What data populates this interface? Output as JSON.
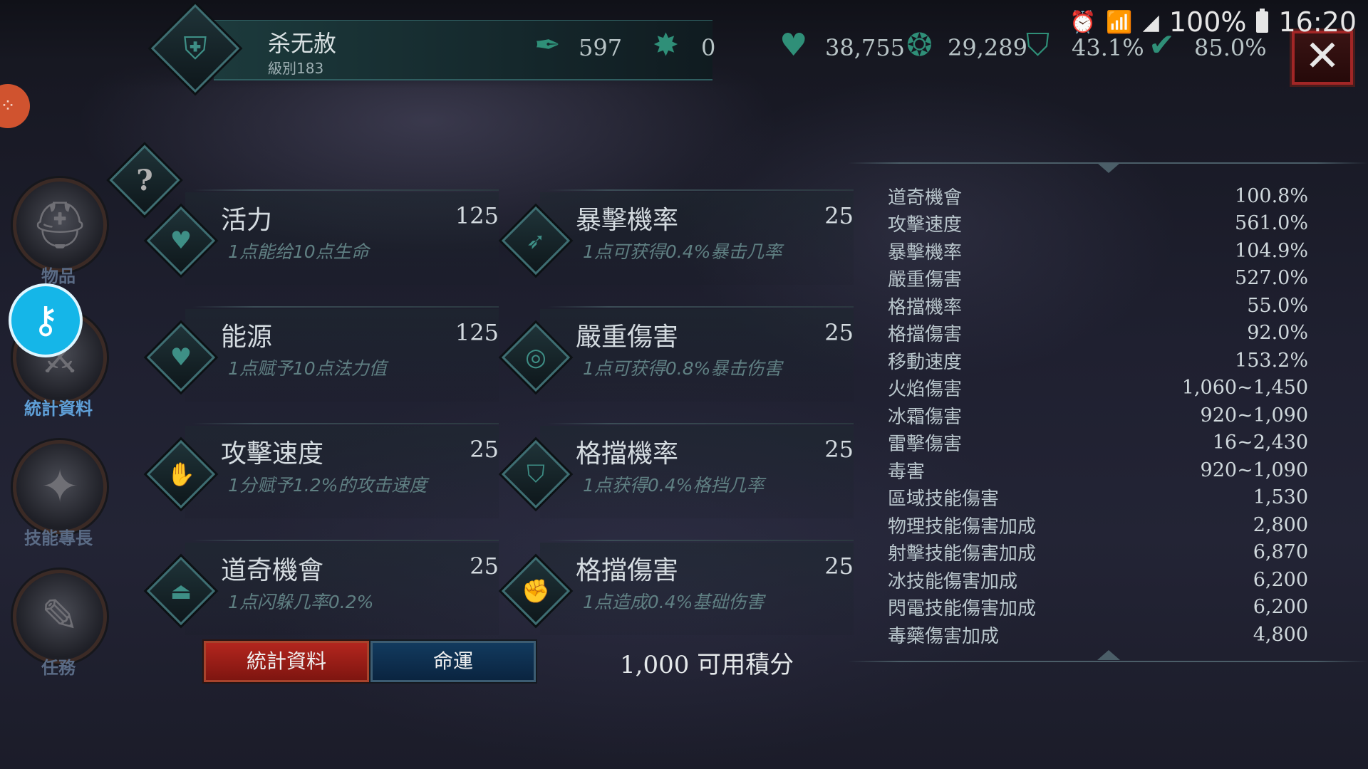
{
  "status_bar": {
    "battery": "100%",
    "time": "16:20",
    "alarm_icon": "alarm-icon",
    "wifi_icon": "wifi-icon",
    "signal_icon": "signal-icon"
  },
  "character": {
    "name": "杀无赦",
    "level": "級別183",
    "portrait_icon": "spartan-helmet-icon"
  },
  "resources": [
    {
      "icon": "feather-icon",
      "value": "597"
    },
    {
      "icon": "splash-icon",
      "value": "0"
    },
    {
      "icon": "heart-icon",
      "value": "38,755"
    },
    {
      "icon": "flame-icon",
      "value": "29,289"
    },
    {
      "icon": "shield-icon",
      "value": "43.1%"
    },
    {
      "icon": "shield-check-icon",
      "value": "85.0%"
    }
  ],
  "nav": [
    {
      "label": "物品",
      "icon": "helmet-icon",
      "active": false
    },
    {
      "label": "統計資料",
      "icon": "crossed-swords-icon",
      "active": true
    },
    {
      "label": "技能專長",
      "icon": "star-skill-icon",
      "active": false
    },
    {
      "label": "任務",
      "icon": "scroll-quill-icon",
      "active": false
    }
  ],
  "attributes": {
    "left": [
      {
        "name": "活力",
        "value": "125",
        "desc": "1点能给10点生命",
        "icon": "heart-icon"
      },
      {
        "name": "能源",
        "value": "125",
        "desc": "1点赋予10点法力值",
        "icon": "heart-icon"
      },
      {
        "name": "攻擊速度",
        "value": "25",
        "desc": "1分赋予1.2%的攻击速度",
        "icon": "gauntlet-icon"
      },
      {
        "name": "道奇機會",
        "value": "25",
        "desc": "1点闪躲几率0.2%",
        "icon": "boot-icon"
      }
    ],
    "right": [
      {
        "name": "暴擊機率",
        "value": "25",
        "desc": "1点可获得0.4%暴击几率",
        "icon": "crossbow-icon"
      },
      {
        "name": "嚴重傷害",
        "value": "25",
        "desc": "1点可获得0.8%暴击伤害",
        "icon": "target-icon"
      },
      {
        "name": "格擋機率",
        "value": "25",
        "desc": "1点获得0.4%格挡几率",
        "icon": "shield-icon"
      },
      {
        "name": "格擋傷害",
        "value": "25",
        "desc": "1点造成0.4%基础伤害",
        "icon": "fist-icon"
      }
    ]
  },
  "buttons": {
    "stats": "統計資料",
    "fate": "命運"
  },
  "points": "1,000 可用積分",
  "stats": [
    {
      "name": "道奇機會",
      "value": "100.8%"
    },
    {
      "name": "攻擊速度",
      "value": "561.0%"
    },
    {
      "name": "暴擊機率",
      "value": "104.9%"
    },
    {
      "name": "嚴重傷害",
      "value": "527.0%"
    },
    {
      "name": "格擋機率",
      "value": "55.0%"
    },
    {
      "name": "格擋傷害",
      "value": "92.0%"
    },
    {
      "name": "移動速度",
      "value": "153.2%"
    },
    {
      "name": "火焰傷害",
      "value": "1,060~1,450"
    },
    {
      "name": "冰霜傷害",
      "value": "920~1,090"
    },
    {
      "name": "雷擊傷害",
      "value": "16~2,430"
    },
    {
      "name": "毒害",
      "value": "920~1,090"
    },
    {
      "name": "區域技能傷害",
      "value": "1,530"
    },
    {
      "name": "物理技能傷害加成",
      "value": "2,800"
    },
    {
      "name": "射擊技能傷害加成",
      "value": "6,870"
    },
    {
      "name": "冰技能傷害加成",
      "value": "6,200"
    },
    {
      "name": "閃電技能傷害加成",
      "value": "6,200"
    },
    {
      "name": "毒藥傷害加成",
      "value": "4,800"
    }
  ],
  "colors": {
    "accent_teal": "#2f8f78",
    "button_red": "#b3261e",
    "button_blue": "#123a5e",
    "badge_cyan": "#15b6e8"
  }
}
